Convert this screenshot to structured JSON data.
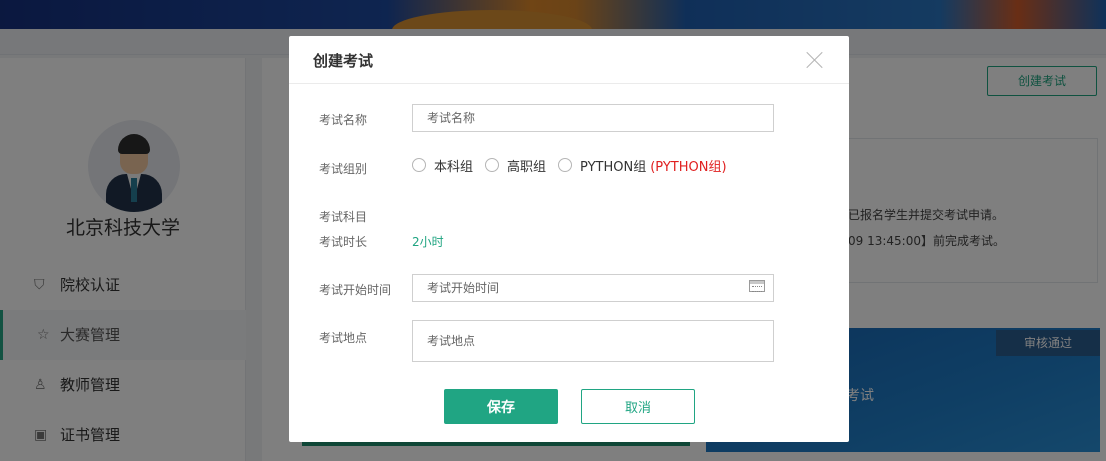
{
  "background": {
    "school_name": "北京科技大学",
    "sidebar_items": [
      {
        "label": "院校认证",
        "icon": "shield-check-icon"
      },
      {
        "label": "大赛管理",
        "icon": "star-outline-icon",
        "active": true
      },
      {
        "label": "教师管理",
        "icon": "user-icon"
      },
      {
        "label": "证书管理",
        "icon": "certificate-icon"
      }
    ],
    "create_button": "创建考试",
    "info_line_1": "已报名学生并提交考试申请。",
    "info_line_2": "09 13:45:00】前完成考试。",
    "status_badge": "审核通过",
    "card_text": "考试"
  },
  "modal": {
    "title": "创建考试",
    "fields": {
      "exam_name": {
        "label": "考试名称",
        "placeholder": "考试名称"
      },
      "exam_group": {
        "label": "考试组别",
        "options": [
          "本科组",
          "高职组",
          "PYTHON组"
        ],
        "note": "(PYTHON组)"
      },
      "exam_subject": {
        "label": "考试科目"
      },
      "exam_duration": {
        "label": "考试时长",
        "value": "2小时"
      },
      "start_time": {
        "label": "考试开始时间",
        "placeholder": "考试开始时间"
      },
      "location": {
        "label": "考试地点",
        "placeholder": "考试地点"
      }
    },
    "save_label": "保存",
    "cancel_label": "取消"
  },
  "colors": {
    "accent": "#20a583",
    "warning_text": "#e02020",
    "overlay": "rgba(0,0,0,0.5)"
  }
}
